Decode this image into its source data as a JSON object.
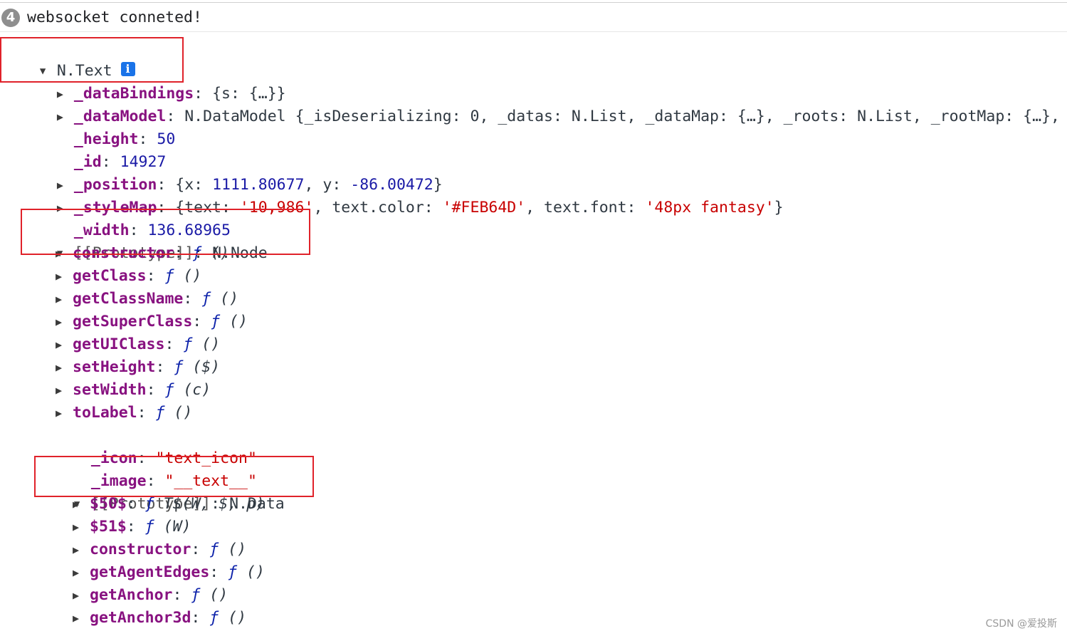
{
  "console": {
    "message_count": "4",
    "message_text": "websocket conneted!"
  },
  "object": {
    "root_label": "N.Text",
    "info_icon_glyph": "i",
    "props": {
      "dataBindings": {
        "key": "_dataBindings",
        "sep": ": ",
        "value": "{s: {…}}"
      },
      "dataModel": {
        "key": "_dataModel",
        "sep": ": ",
        "value": "N.DataModel {_isDeserializing: 0, _datas: N.List, _dataMap: {…}, _roots: N.List, _rootMap: {…},"
      },
      "height": {
        "key": "_height",
        "sep": ": ",
        "value": "50"
      },
      "id": {
        "key": "_id",
        "sep": ": ",
        "value": "14927"
      },
      "position": {
        "key": "_position",
        "sep": ": ",
        "open": "{x: ",
        "x": "1111.80677",
        "mid": ", y: ",
        "y": "-86.00472",
        "close": "}"
      },
      "styleMap": {
        "key": "_styleMap",
        "sep": ": ",
        "open": "{text: ",
        "text": "'10,986'",
        "c1": ", text.color: ",
        "color": "'#FEB64D'",
        "c2": ", text.font: ",
        "font": "'48px fantasy'",
        "close": "}"
      },
      "width": {
        "key": "_width",
        "sep": ": ",
        "value": "136.68965"
      }
    },
    "proto_node": {
      "key": "[[Prototype]]",
      "sep": ": ",
      "value": "N.Node",
      "methods": [
        {
          "name": "constructor",
          "sig": "()"
        },
        {
          "name": "getClass",
          "sig": "()"
        },
        {
          "name": "getClassName",
          "sig": "()"
        },
        {
          "name": "getSuperClass",
          "sig": "()"
        },
        {
          "name": "getUIClass",
          "sig": "()"
        },
        {
          "name": "setHeight",
          "sig": "($)"
        },
        {
          "name": "setWidth",
          "sig": "(c)"
        },
        {
          "name": "toLabel",
          "sig": "()"
        }
      ],
      "icon": {
        "key": "_icon",
        "sep": ": ",
        "value": "\"text_icon\""
      },
      "image": {
        "key": "_image",
        "sep": ": ",
        "value": "\"__text__\""
      }
    },
    "proto_data": {
      "key": "[[Prototype]]",
      "sep": ": ",
      "value": "N.Data",
      "methods": [
        {
          "name": "$50$",
          "sig": "T$(W, $, p)"
        },
        {
          "name": "$51$",
          "sig": "(W)"
        },
        {
          "name": "constructor",
          "sig": "()"
        },
        {
          "name": "getAgentEdges",
          "sig": "()"
        },
        {
          "name": "getAnchor",
          "sig": "()"
        },
        {
          "name": "getAnchor3d",
          "sig": "()"
        }
      ]
    },
    "fn_symbol": "ƒ",
    "collapsed_arrow": "▶",
    "expanded_arrow": "▼"
  },
  "watermark": "CSDN @爱投斯",
  "colors": {
    "key": "#881280",
    "number": "#1a1aa6",
    "string": "#c80000",
    "highlight_box": "#e0222a",
    "info_icon": "#1a73e8"
  }
}
